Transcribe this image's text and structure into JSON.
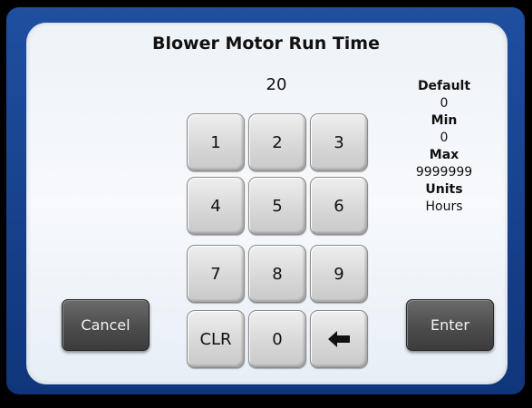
{
  "dialog": {
    "title": "Blower Motor Run Time",
    "current_value": "20"
  },
  "info": {
    "default_label": "Default",
    "default_value": "0",
    "min_label": "Min",
    "min_value": "0",
    "max_label": "Max",
    "max_value": "9999999",
    "units_label": "Units",
    "units_value": "Hours"
  },
  "keypad": {
    "k1": "1",
    "k2": "2",
    "k3": "3",
    "k4": "4",
    "k5": "5",
    "k6": "6",
    "k7": "7",
    "k8": "8",
    "k9": "9",
    "clr": "CLR",
    "k0": "0",
    "backspace_icon": "left-arrow-icon"
  },
  "buttons": {
    "cancel": "Cancel",
    "enter": "Enter"
  }
}
